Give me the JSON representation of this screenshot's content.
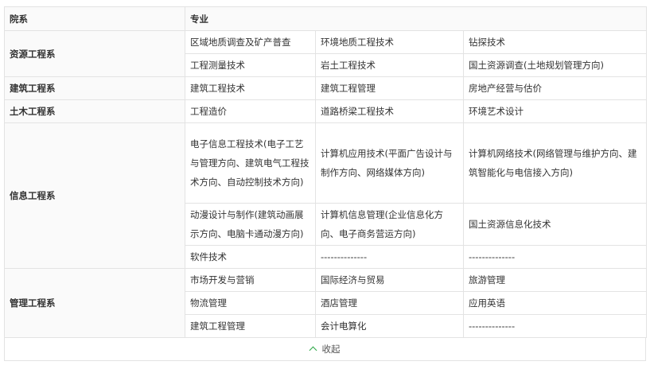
{
  "header": {
    "col1": "院系",
    "col2": "专业"
  },
  "departments": {
    "ziyuan": "资源工程系",
    "jianzhu": "建筑工程系",
    "tumu": "土木工程系",
    "xinxi": "信息工程系",
    "guanli": "管理工程系"
  },
  "rows": {
    "r1": [
      "区域地质调查及矿产普查",
      "环境地质工程技术",
      "钻探技术"
    ],
    "r2": [
      "工程测量技术",
      "岩土工程技术",
      "国土资源调查(土地规划管理方向)"
    ],
    "r3": [
      "建筑工程技术",
      "建筑工程管理",
      "房地产经营与估价"
    ],
    "r4": [
      "工程造价",
      "道路桥梁工程技术",
      "环境艺术设计"
    ],
    "r5": [
      "电子信息工程技术(电子工艺与管理方向、建筑电气工程技术方向、自动控制技术方向)",
      "计算机应用技术(平面广告设计与制作方向、网络媒体方向)",
      "计算机网络技术(网络管理与维护方向、建筑智能化与电信接入方向)"
    ],
    "r6": [
      "动漫设计与制作(建筑动画展示方向、电脑卡通动漫方向)",
      "计算机信息管理(企业信息化方向、电子商务营运方向)",
      "国土资源信息化技术"
    ],
    "r7": [
      "软件技术",
      "--------------",
      "--------------"
    ],
    "r8": [
      "市场开发与营销",
      "国际经济与贸易",
      "旅游管理"
    ],
    "r9": [
      "物流管理",
      "酒店管理",
      "应用英语"
    ],
    "r10": [
      "建筑工程管理",
      "会计电算化",
      "--------------"
    ]
  },
  "footer": {
    "collapse_label": "收起",
    "icon": "chevron-up-icon",
    "accent": "#2aa745"
  }
}
